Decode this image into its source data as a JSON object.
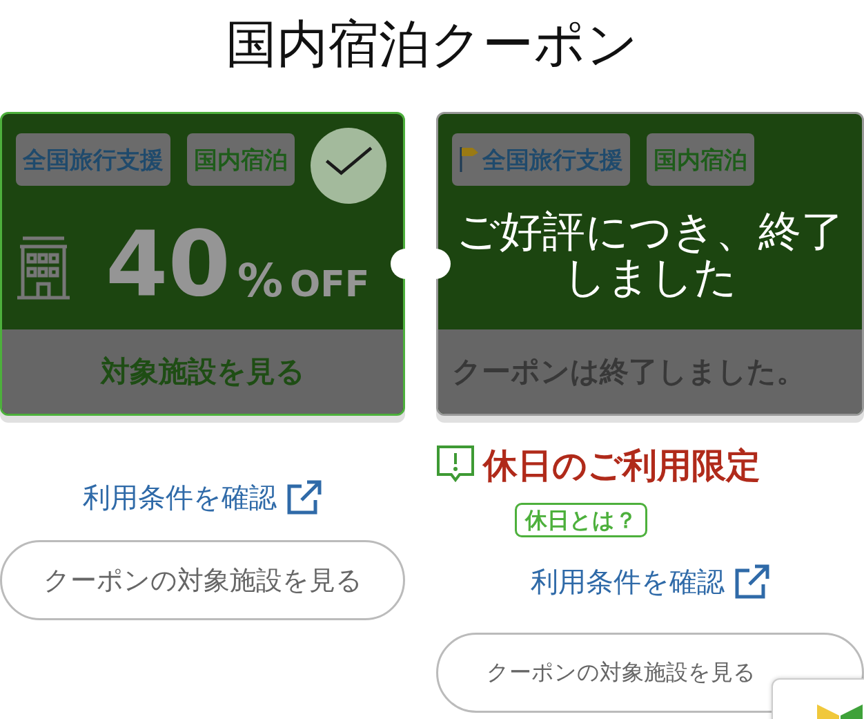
{
  "title": "国内宿泊クーポン",
  "coupons": [
    {
      "tags": [
        {
          "label": "全国旅行支援",
          "kind": "campaign",
          "flag": false
        },
        {
          "label": "国内宿泊",
          "kind": "category",
          "flag": false
        }
      ],
      "discount": "40",
      "unit": "%",
      "off": "OFF",
      "action": "対象施設を見る",
      "checked": true,
      "ended": false,
      "terms_link": "利用条件を確認",
      "facilities_button": "クーポンの対象施設を見る"
    },
    {
      "tags": [
        {
          "label": "全国旅行支援",
          "kind": "campaign",
          "flag": true
        },
        {
          "label": "国内宿泊",
          "kind": "category",
          "flag": false
        }
      ],
      "action": "クーポンは終了しました。",
      "checked": false,
      "ended": true,
      "ended_message": "ご好評につき、終了しました",
      "notice": {
        "text": "休日のご利用限定",
        "help": "休日とは？"
      },
      "terms_link": "利用条件を確認",
      "facilities_button": "クーポンの対象施設を見る"
    }
  ]
}
